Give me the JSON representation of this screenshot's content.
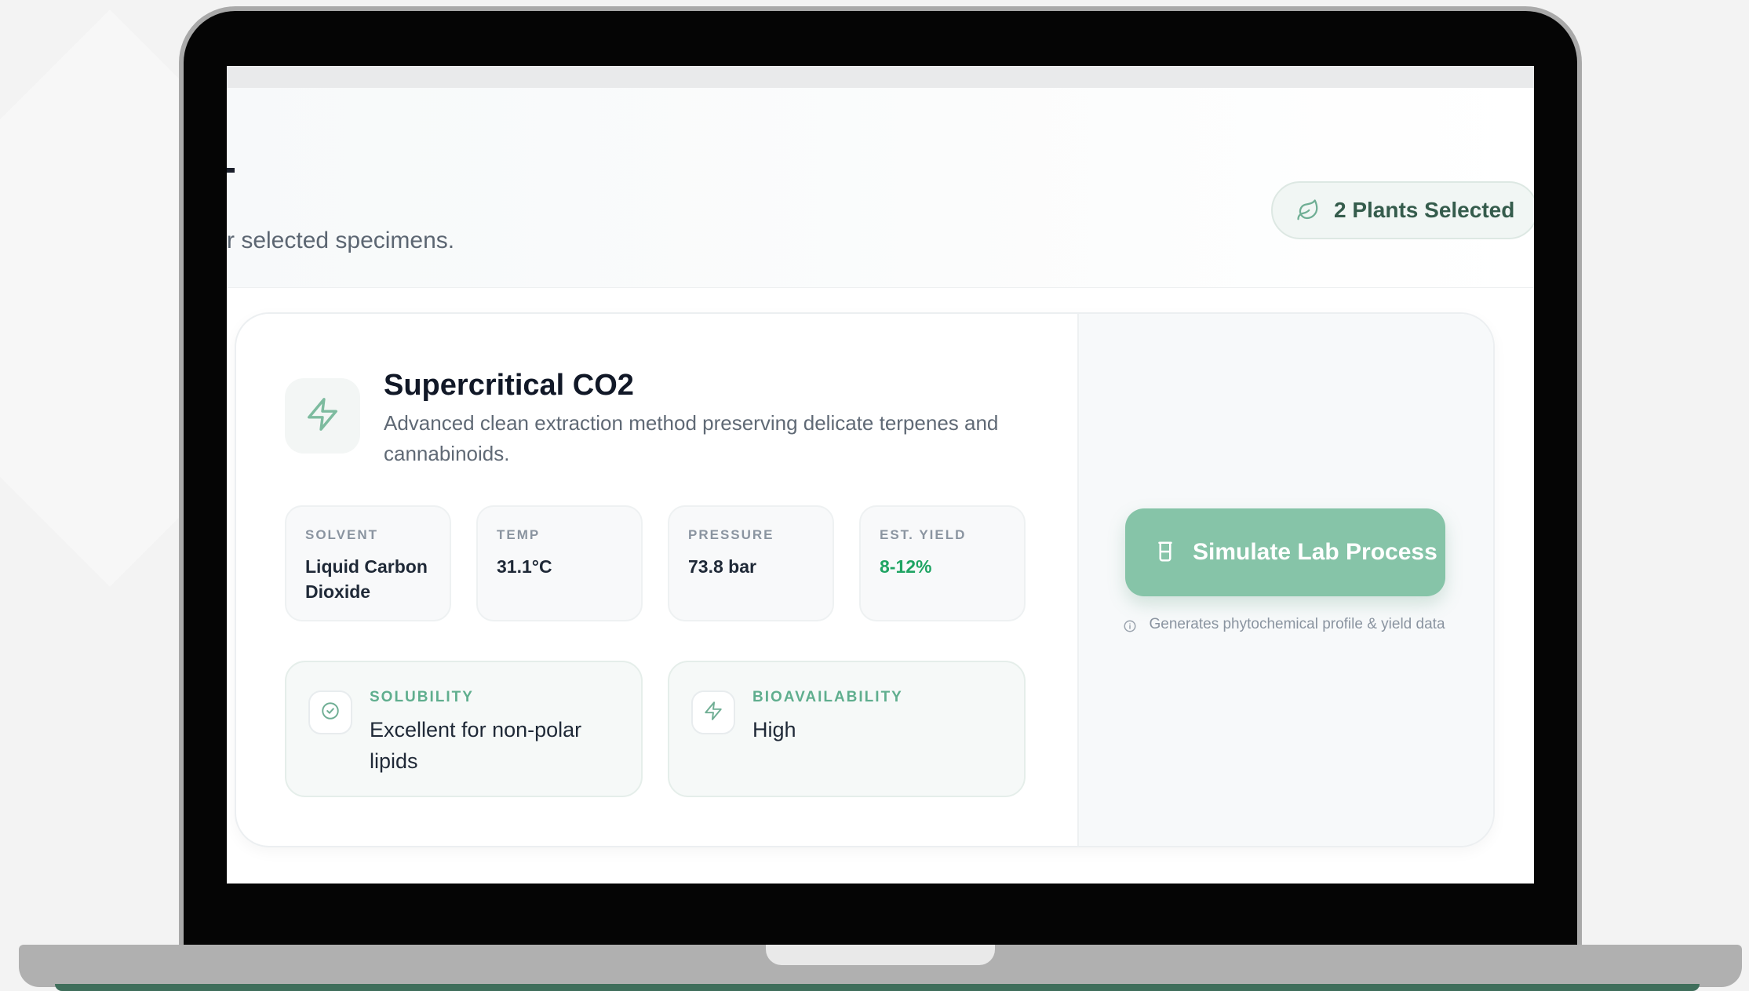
{
  "header": {
    "subtitle": "r selected specimens.",
    "plants_selected": "2 Plants Selected"
  },
  "method": {
    "title": "Supercritical CO2",
    "description": "Advanced clean extraction method preserving delicate terpenes and cannabinoids.",
    "stats": [
      {
        "label": "SOLVENT",
        "value": "Liquid Carbon Dioxide"
      },
      {
        "label": "TEMP",
        "value": "31.1°C"
      },
      {
        "label": "PRESSURE",
        "value": "73.8 bar"
      },
      {
        "label": "EST. YIELD",
        "value": "8-12%"
      }
    ],
    "features": [
      {
        "label": "SOLUBILITY",
        "value": "Excellent for non-polar lipids",
        "icon": "check-circle-icon"
      },
      {
        "label": "BIOAVAILABILITY",
        "value": "High",
        "icon": "lightning-icon"
      }
    ]
  },
  "action": {
    "simulate_label": "Simulate Lab Process",
    "hint": "Generates phytochemical profile & yield data"
  },
  "colors": {
    "accent": "#86c4a8",
    "yield": "#1fa463",
    "feature_label": "#5fae8e"
  }
}
